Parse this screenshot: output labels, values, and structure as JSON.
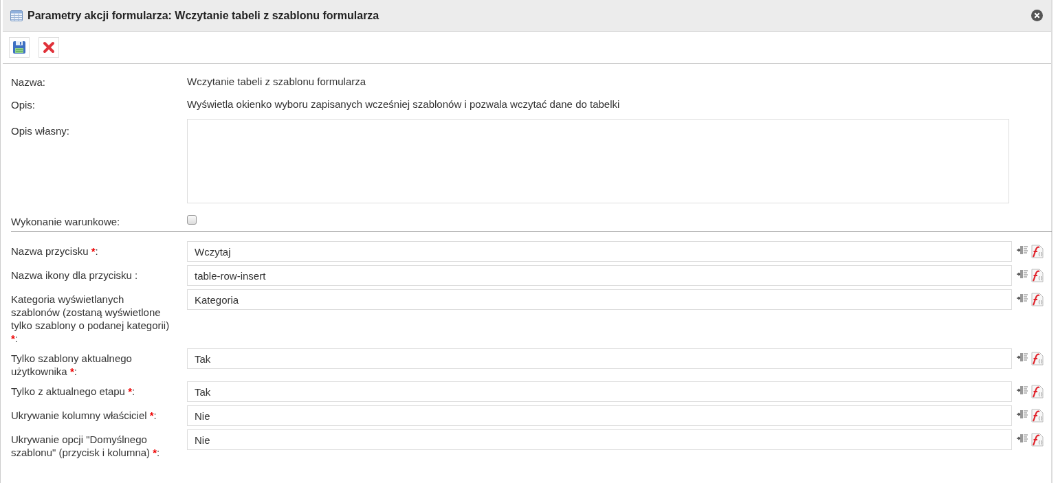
{
  "window": {
    "title": "Parametry akcji formularza: Wczytanie tabeli z szablonu formularza"
  },
  "info": [
    {
      "label": "Nazwa:",
      "value": "Wczytanie tabeli z szablonu formularza"
    },
    {
      "label": "Opis:",
      "value": "Wyświetla okienko wyboru zapisanych wcześniej szablonów i pozwala wczytać dane do tabelki"
    }
  ],
  "own_description": {
    "label": "Opis własny:"
  },
  "conditional": {
    "label": "Wykonanie warunkowe:",
    "checked": false
  },
  "params": [
    {
      "label": "Nazwa przycisku ",
      "required": "*",
      "end": ":",
      "value": "Wczytaj"
    },
    {
      "label": "Nazwa ikony dla przycisku :",
      "value": "table-row-insert"
    },
    {
      "label": "Kategoria wyświetlanych szablonów (zostaną wyświetlone tylko szablony o podanej kategorii) ",
      "required": "*",
      "end": ":",
      "value": "Kategoria"
    },
    {
      "label": "Tylko szablony aktualnego użytkownika ",
      "required": "*",
      "end": ":",
      "value": "Tak"
    },
    {
      "label": "Tylko z aktualnego etapu ",
      "required": "*",
      "end": ":",
      "value": "Tak"
    },
    {
      "label": "Ukrywanie kolumny właściciel ",
      "required": "*",
      "end": ":",
      "value": "Nie"
    },
    {
      "label": "Ukrywanie opcji \"Domyślnego szablonu\" (przycisk i kolumna) ",
      "required": "*",
      "end": ":",
      "value": "Nie"
    }
  ]
}
